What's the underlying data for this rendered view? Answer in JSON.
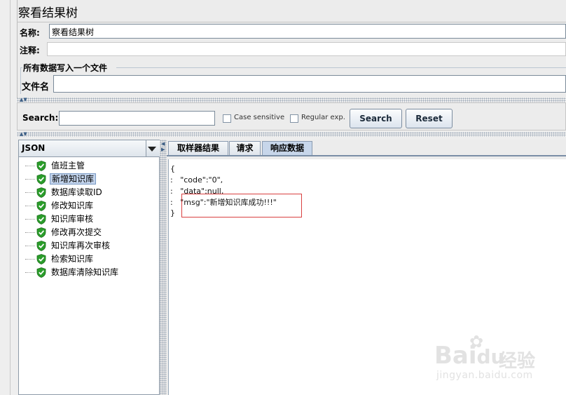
{
  "window": {
    "title": "察看结果树"
  },
  "form": {
    "name_label": "名称:",
    "name_value": "察看结果树",
    "comment_label": "注释:",
    "comment_value": "",
    "fieldset_title": "所有数据写入一个文件",
    "filename_label": "文件名",
    "filename_value": ""
  },
  "search": {
    "label": "Search:",
    "value": "",
    "case_sensitive_label": "Case sensitive",
    "case_sensitive_checked": false,
    "regex_label": "Regular exp.",
    "regex_checked": false,
    "search_button": "Search",
    "reset_button": "Reset"
  },
  "renderer": {
    "selected": "JSON"
  },
  "tree": {
    "items": [
      {
        "label": "值班主管",
        "status": "success"
      },
      {
        "label": "新增知识库",
        "status": "success",
        "selected": true
      },
      {
        "label": "数据库读取ID",
        "status": "success"
      },
      {
        "label": "修改知识库",
        "status": "success"
      },
      {
        "label": "知识库审核",
        "status": "success"
      },
      {
        "label": "修改再次提交",
        "status": "success"
      },
      {
        "label": "知识库再次审核",
        "status": "success"
      },
      {
        "label": "检索知识库",
        "status": "success"
      },
      {
        "label": "数据库清除知识库",
        "status": "success"
      }
    ]
  },
  "tabs": [
    {
      "label": "取样器结果",
      "active": false
    },
    {
      "label": "请求",
      "active": false
    },
    {
      "label": "响应数据",
      "active": true
    }
  ],
  "response": {
    "lines": [
      "{",
      ":   \"code\":\"0\",",
      ":   \"data\":null,",
      ":   \"msg\":\"新增知识库成功!!!\"",
      "}"
    ]
  },
  "icons": {
    "tree_status": "green-check-shield-icon",
    "combo_arrow": "triangle-down-icon",
    "divider_up": "arrow-up-icon",
    "divider_down": "arrow-down-icon",
    "split_left": "arrow-left-icon",
    "split_right": "arrow-right-icon"
  },
  "watermark": {
    "brand": "Bai",
    "brand2": "经验",
    "url": "jingyan.baidu.com"
  },
  "colors": {
    "success_green": "#2a9d2a",
    "highlight_box": "#d94040",
    "selection": "#c3d4ec"
  }
}
